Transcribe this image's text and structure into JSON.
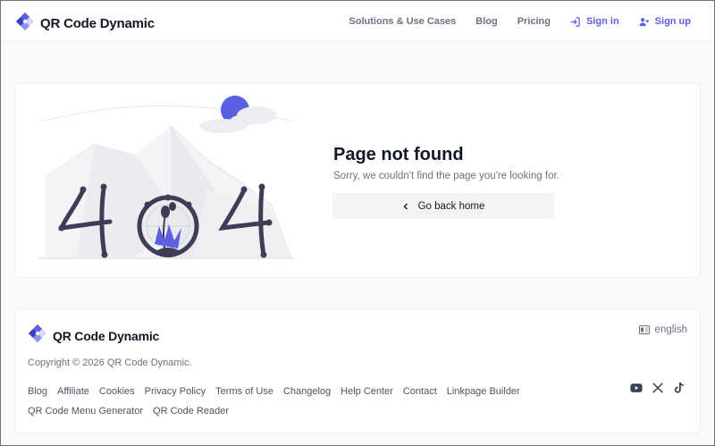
{
  "header": {
    "brand": "QR Code Dynamic",
    "nav": {
      "solutions": "Solutions & Use Cases",
      "blog": "Blog",
      "pricing": "Pricing",
      "signin": "Sign in",
      "signup": "Sign up"
    }
  },
  "error": {
    "title": "Page not found",
    "subtitle": "Sorry, we couldn't find the page you're looking for.",
    "back_label": "Go back home",
    "illustration": "404-icon"
  },
  "footer": {
    "brand": "QR Code Dynamic",
    "language": "english",
    "copyright": "Copyright © 2026 QR Code Dynamic.",
    "links": [
      "Blog",
      "Affiliate",
      "Cookies",
      "Privacy Policy",
      "Terms of Use",
      "Changelog",
      "Help Center",
      "Contact",
      "Linkpage Builder",
      "QR Code Menu Generator",
      "QR Code Reader"
    ],
    "social": [
      "youtube-icon",
      "x-icon",
      "tiktok-icon"
    ]
  },
  "colors": {
    "accent": "#5b5fe0",
    "text": "#111827",
    "muted": "#6b7280",
    "ink": "#3f3d56"
  }
}
